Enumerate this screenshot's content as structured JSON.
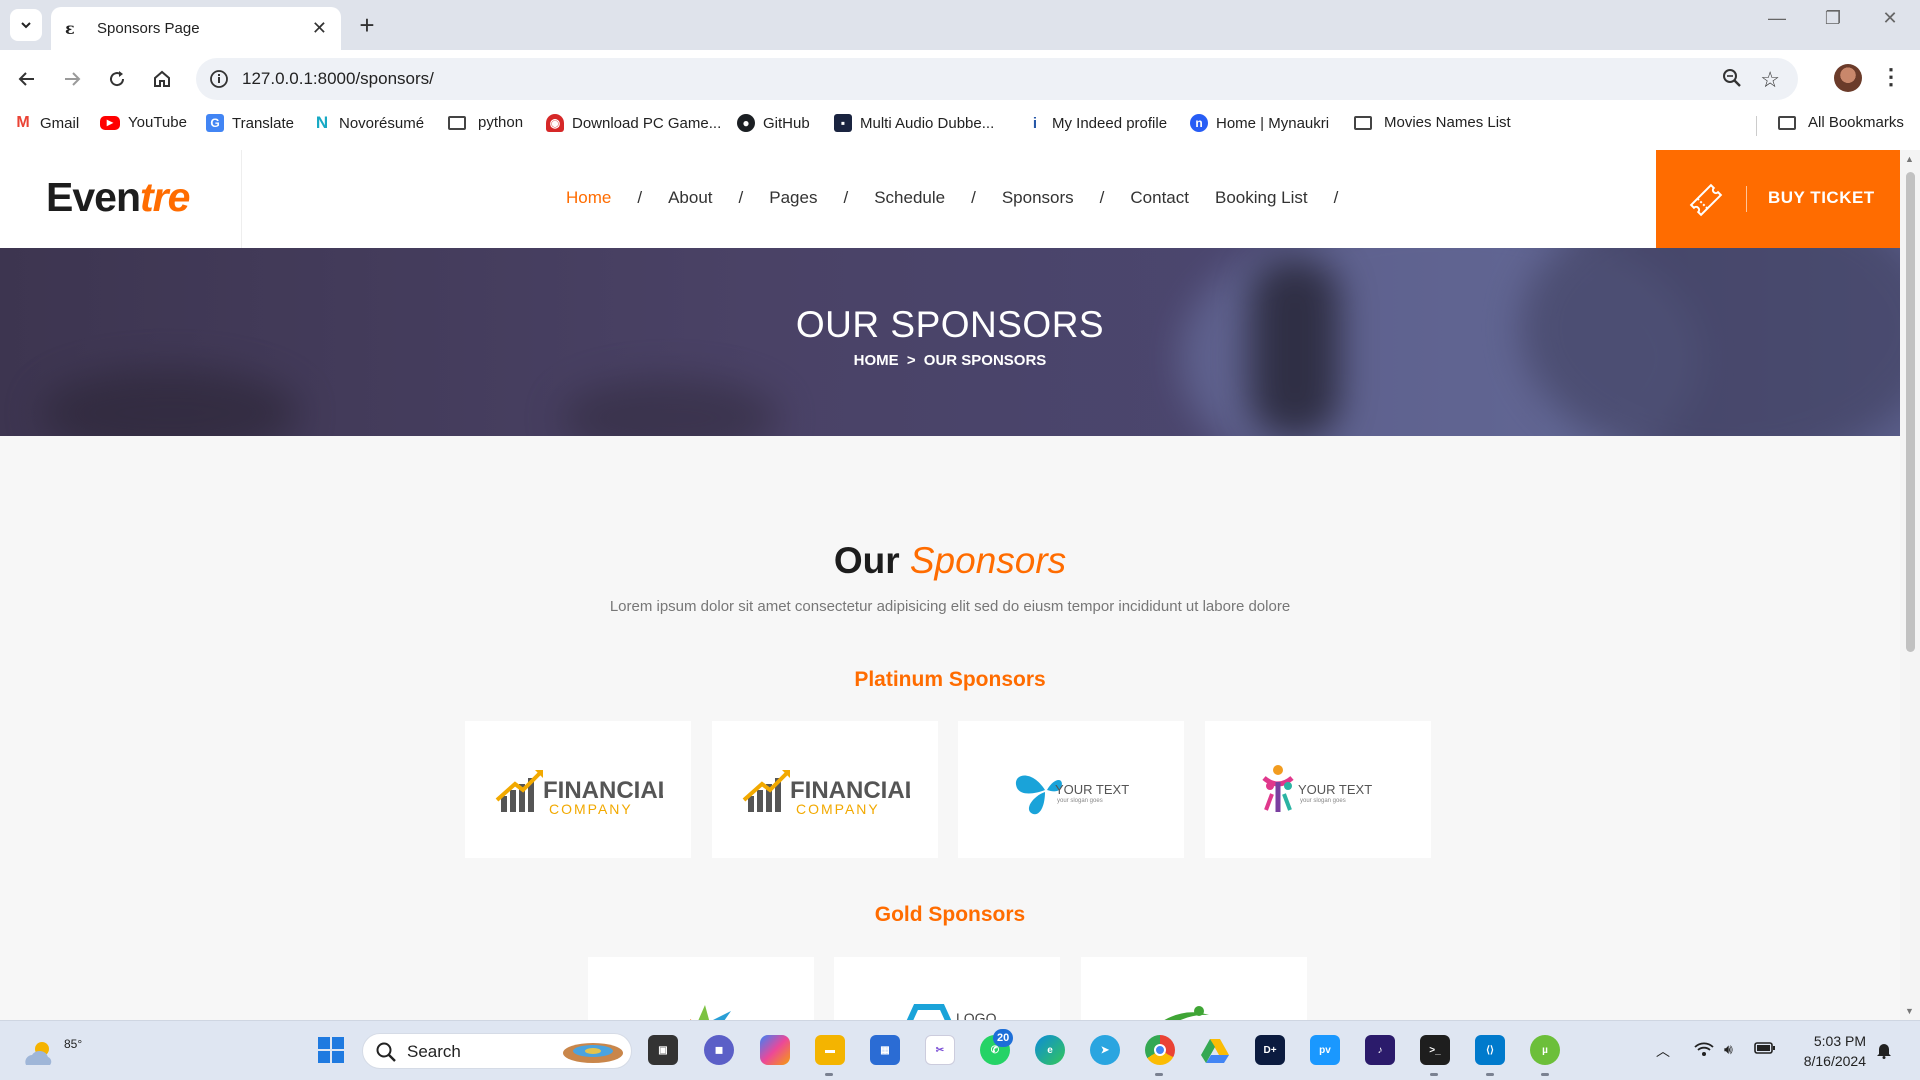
{
  "browser": {
    "tab_title": "Sponsors Page",
    "tab_favicon": "ε",
    "url": "127.0.0.1:8000/sponsors/",
    "bookmarks": [
      {
        "label": "Gmail",
        "icon": "gmail-icon"
      },
      {
        "label": "YouTube",
        "icon": "youtube-icon"
      },
      {
        "label": "Translate",
        "icon": "translate-icon"
      },
      {
        "label": "Novorésumé",
        "icon": "novoresume-icon"
      },
      {
        "label": "python",
        "icon": "folder-icon"
      },
      {
        "label": "Download PC Game...",
        "icon": "game-icon"
      },
      {
        "label": "GitHub",
        "icon": "github-icon"
      },
      {
        "label": "Multi Audio Dubbe...",
        "icon": "dubbing-icon"
      },
      {
        "label": "My Indeed profile",
        "icon": "indeed-icon"
      },
      {
        "label": "Home | Mynaukri",
        "icon": "naukri-icon"
      },
      {
        "label": "Movies Names List",
        "icon": "folder-icon"
      }
    ],
    "all_bookmarks": "All Bookmarks"
  },
  "site": {
    "logo_main": "Even",
    "logo_accent": "tre",
    "nav": [
      {
        "label": "Home",
        "active": true
      },
      {
        "label": "About"
      },
      {
        "label": "Pages"
      },
      {
        "label": "Schedule"
      },
      {
        "label": "Sponsors"
      },
      {
        "label": "Contact"
      },
      {
        "label": "Booking List"
      }
    ],
    "nav_separator": "/",
    "buy_ticket": "BUY TICKET",
    "accent_color": "#ff6c00"
  },
  "hero": {
    "title": "OUR SPONSORS",
    "breadcrumb_home": "HOME",
    "breadcrumb_sep": ">",
    "breadcrumb_current": "OUR SPONSORS"
  },
  "sponsors": {
    "title_main": "Our",
    "title_accent": "Sponsors",
    "subtitle": "Lorem ipsum dolor sit amet consectetur adipisicing elit sed do eiusm tempor incididunt ut labore dolore",
    "platinum_title": "Platinum Sponsors",
    "gold_title": "Gold Sponsors",
    "platinum": [
      {
        "name": "FINANCIAL",
        "tag": "COMPANY",
        "logo": "financial-logo"
      },
      {
        "name": "FINANCIAL",
        "tag": "COMPANY",
        "logo": "financial-logo"
      },
      {
        "name": "YOUR TEXT",
        "tag": "your slogan goes",
        "logo": "butterfly-logo"
      },
      {
        "name": "YOUR TEXT",
        "tag": "your slogan goes",
        "logo": "people-logo"
      }
    ],
    "gold": [
      {
        "logo": "leaf-logo"
      },
      {
        "name": "LOGO",
        "logo": "hexagon-logo"
      },
      {
        "logo": "swoosh-logo"
      }
    ]
  },
  "taskbar": {
    "temperature": "85°",
    "search": "Search",
    "whatsapp_badge": "20",
    "time": "5:03 PM",
    "date": "8/16/2024"
  }
}
